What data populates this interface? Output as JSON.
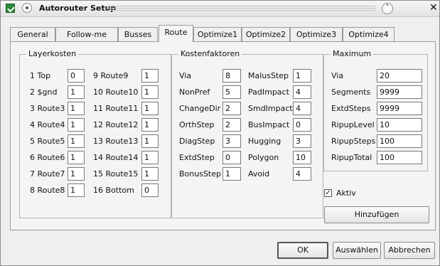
{
  "window": {
    "title": "Autorouter Setup"
  },
  "tabs": [
    {
      "label": "General"
    },
    {
      "label": "Follow-me"
    },
    {
      "label": "Busses"
    },
    {
      "label": "Route"
    },
    {
      "label": "Optimize1"
    },
    {
      "label": "Optimize2"
    },
    {
      "label": "Optimize3"
    },
    {
      "label": "Optimize4"
    }
  ],
  "active_tab": "Route",
  "layerkosten": {
    "title": "Layerkosten",
    "left": [
      {
        "label": "1 Top",
        "value": "0"
      },
      {
        "label": "2 $gnd",
        "value": "1"
      },
      {
        "label": "3 Route3",
        "value": "1"
      },
      {
        "label": "4 Route4",
        "value": "1"
      },
      {
        "label": "5 Route5",
        "value": "1"
      },
      {
        "label": "6 Route6",
        "value": "1"
      },
      {
        "label": "7 Route7",
        "value": "1"
      },
      {
        "label": "8 Route8",
        "value": "1"
      }
    ],
    "right": [
      {
        "label": "9 Route9",
        "value": "1"
      },
      {
        "label": "10 Route10",
        "value": "1"
      },
      {
        "label": "11 Route11",
        "value": "1"
      },
      {
        "label": "12 Route12",
        "value": "1"
      },
      {
        "label": "13 Route13",
        "value": "1"
      },
      {
        "label": "14 Route14",
        "value": "1"
      },
      {
        "label": "15 Route15",
        "value": "1"
      },
      {
        "label": "16 Bottom",
        "value": "0"
      }
    ]
  },
  "kostenfaktoren": {
    "title": "Kostenfaktoren",
    "left": [
      {
        "label": "Via",
        "value": "8"
      },
      {
        "label": "NonPref",
        "value": "5"
      },
      {
        "label": "ChangeDir",
        "value": "2"
      },
      {
        "label": "OrthStep",
        "value": "2"
      },
      {
        "label": "DiagStep",
        "value": "3"
      },
      {
        "label": "ExtdStep",
        "value": "0"
      },
      {
        "label": "BonusStep",
        "value": "1"
      }
    ],
    "right": [
      {
        "label": "MalusStep",
        "value": "1"
      },
      {
        "label": "PadImpact",
        "value": "4"
      },
      {
        "label": "SmdImpact",
        "value": "4"
      },
      {
        "label": "BusImpact",
        "value": "0"
      },
      {
        "label": "Hugging",
        "value": "3"
      },
      {
        "label": "Polygon",
        "value": "10"
      },
      {
        "label": "Avoid",
        "value": "4"
      }
    ]
  },
  "maximum": {
    "title": "Maximum",
    "rows": [
      {
        "label": "Via",
        "value": "20"
      },
      {
        "label": "Segments",
        "value": "9999"
      },
      {
        "label": "ExtdSteps",
        "value": "9999"
      },
      {
        "label": "RipupLevel",
        "value": "10"
      },
      {
        "label": "RipupSteps",
        "value": "100"
      },
      {
        "label": "RipupTotal",
        "value": "100"
      }
    ]
  },
  "aktiv": {
    "label": "Aktiv",
    "checked": true,
    "mark": "✓"
  },
  "buttons": {
    "add": "Hinzufügen",
    "ok": "OK",
    "select": "Auswählen",
    "cancel": "Abbrechen"
  },
  "icons": {
    "app": "app-icon",
    "menu": "window-menu-icon",
    "shade": "chevron-up-icon",
    "close": "close-icon"
  }
}
